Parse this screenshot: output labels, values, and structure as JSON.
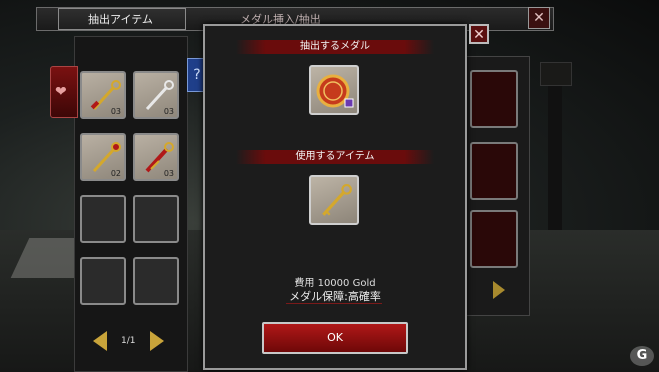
{
  "window": {
    "title": "メダル挿入/抽出"
  },
  "left_panel": {
    "header_label": "抽出アイテム",
    "slots": [
      {
        "item": "gold-red-key",
        "count": "03"
      },
      {
        "item": "silver-key",
        "count": "03"
      },
      {
        "item": "gold-red-key",
        "count": "02"
      },
      {
        "item": "red-gold-key",
        "count": "03"
      },
      {
        "item": "",
        "count": ""
      },
      {
        "item": "",
        "count": ""
      },
      {
        "item": "",
        "count": ""
      },
      {
        "item": "",
        "count": ""
      }
    ],
    "page": "1/1"
  },
  "dialog": {
    "medal_section_label": "抽出するメダル",
    "item_section_label": "使用するアイテム",
    "cost_text": "費用 10000 Gold",
    "guarantee_text": "メダル保障:高確率",
    "ok_label": "OK"
  },
  "colors": {
    "accent_red": "#b01818",
    "gold": "#c9a43a"
  },
  "watermark": "G"
}
